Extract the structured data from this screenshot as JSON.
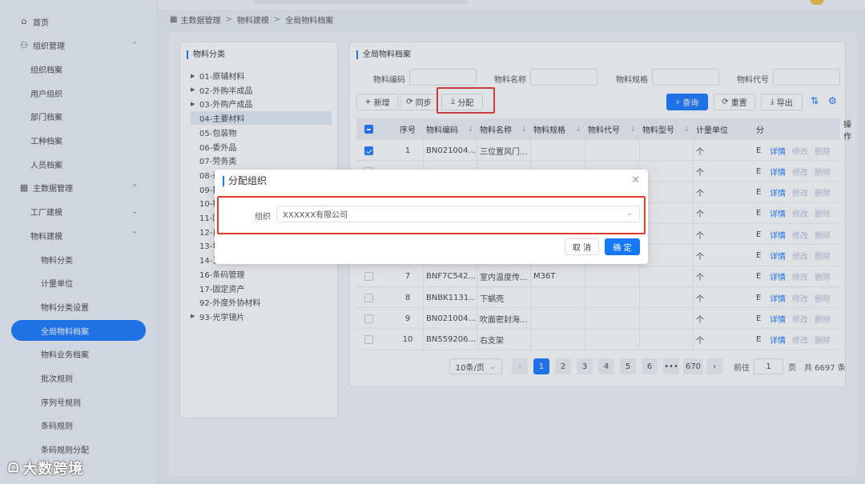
{
  "sidebar": {
    "items": [
      {
        "label": "首页",
        "icon": "home-icon",
        "glyph": "⌂",
        "level": 1,
        "chevron": ""
      },
      {
        "label": "组织管理",
        "icon": "org-icon",
        "glyph": "⚇",
        "level": 1,
        "chevron": "⌃"
      },
      {
        "label": "组织档案",
        "level": 2
      },
      {
        "label": "用户组织",
        "level": 2
      },
      {
        "label": "部门档案",
        "level": 2
      },
      {
        "label": "工种档案",
        "level": 2
      },
      {
        "label": "人员档案",
        "level": 2
      },
      {
        "label": "主数据管理",
        "icon": "data-icon",
        "glyph": "▦",
        "level": 1,
        "chevron": "⌃"
      },
      {
        "label": "工厂建模",
        "level": 2,
        "chevron": "⌄"
      },
      {
        "label": "物料建模",
        "level": 2,
        "chevron": "⌃"
      },
      {
        "label": "物料分类",
        "level": 3
      },
      {
        "label": "计量单位",
        "level": 3
      },
      {
        "label": "物料分类设置",
        "level": 3
      },
      {
        "label": "全局物料档案",
        "level": 3,
        "active": true
      },
      {
        "label": "物料业务档案",
        "level": 3
      },
      {
        "label": "批次规则",
        "level": 3
      },
      {
        "label": "序列号规则",
        "level": 3
      },
      {
        "label": "条码规则",
        "level": 3
      },
      {
        "label": "条码规则分配",
        "level": 3
      }
    ]
  },
  "breadcrumb": [
    "主数据管理",
    "物料建模",
    "全局物料档案"
  ],
  "tree": {
    "title": "物料分类",
    "items": [
      {
        "label": "01-原辅材料",
        "caret": true
      },
      {
        "label": "02-外购半成品",
        "caret": true
      },
      {
        "label": "03-外购产成品",
        "caret": true
      },
      {
        "label": "04-主要材料",
        "selected": true
      },
      {
        "label": "05-包装物"
      },
      {
        "label": "06-委外品"
      },
      {
        "label": "07-劳务类"
      },
      {
        "label": "08-杂"
      },
      {
        "label": "09-指"
      },
      {
        "label": "10-构"
      },
      {
        "label": "11-固"
      },
      {
        "label": "12-自"
      },
      {
        "label": "13-切"
      },
      {
        "label": "14-五"
      },
      {
        "label": "16-条码管理"
      },
      {
        "label": "17-固定资产"
      },
      {
        "label": "92-外度外协材料"
      },
      {
        "label": "93-光学镜片",
        "caret": true
      }
    ]
  },
  "main": {
    "title": "全局物料档案",
    "filters": [
      "物料编码",
      "物料名称",
      "物料规格",
      "物料代号"
    ],
    "buttons": {
      "add": "新增",
      "sync": "同步",
      "assign": "分配",
      "query": "查询",
      "reset": "重置",
      "export": "导出"
    },
    "columns": [
      "序号",
      "物料编码",
      "物料名称",
      "物料规格",
      "物料代号",
      "物料型号",
      "计量单位",
      "分",
      "操作"
    ],
    "rows": [
      {
        "no": "1",
        "code": "BN021004...",
        "name": "三位置风门...",
        "spec": "",
        "unit": "个",
        "c8": "E",
        "checked": true
      },
      {
        "no": "",
        "code": "",
        "name": "",
        "spec": "",
        "unit": "个",
        "c8": "E"
      },
      {
        "no": "",
        "code": "",
        "name": "",
        "spec": "",
        "unit": "个",
        "c8": "E"
      },
      {
        "no": "",
        "code": "",
        "name": "",
        "spec": "",
        "unit": "个",
        "c8": "E"
      },
      {
        "no": "",
        "code": "",
        "name": "",
        "spec": "",
        "unit": "个",
        "c8": "E"
      },
      {
        "no": "",
        "code": "",
        "name": "",
        "spec": "",
        "unit": "个",
        "c8": "E"
      },
      {
        "no": "7",
        "code": "BNF7C542...",
        "name": "室内温度传...",
        "spec": "M36T",
        "unit": "个",
        "c8": "E"
      },
      {
        "no": "8",
        "code": "BNBK1131...",
        "name": "下蜗壳",
        "spec": "",
        "unit": "个",
        "c8": "E"
      },
      {
        "no": "9",
        "code": "BN021004...",
        "name": "吹面密封海...",
        "spec": "",
        "unit": "个",
        "c8": "E"
      },
      {
        "no": "10",
        "code": "BN559206...",
        "name": "右支架",
        "spec": "",
        "unit": "个",
        "c8": "E"
      }
    ],
    "actions": {
      "detail": "详情",
      "edit": "修改",
      "delete": "删除"
    }
  },
  "pagination": {
    "page_size": "10条/页",
    "pages": [
      "1",
      "2",
      "3",
      "4",
      "5",
      "6",
      "•••",
      "670"
    ],
    "goto_label": "前往",
    "goto_value": "1",
    "page_unit": "页",
    "total": "共 6697 条"
  },
  "modal": {
    "title": "分配组织",
    "org_label": "组织",
    "org_value": "XXXXXX有限公司",
    "cancel": "取 消",
    "confirm": "确 定"
  },
  "watermark": "大数跨境",
  "colors": {
    "primary": "#1677ff",
    "highlight": "#e23a2e"
  }
}
